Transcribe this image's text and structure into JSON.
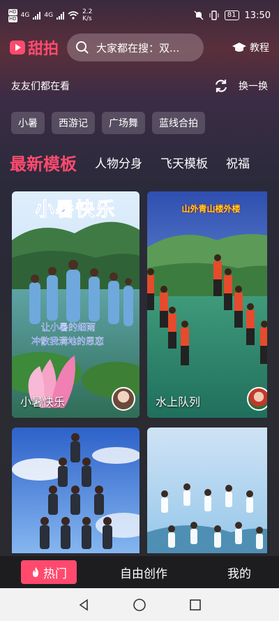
{
  "status_bar": {
    "hd1": "HD",
    "hd2": "HD",
    "net_4g1": "4G",
    "net_4g2": "4G",
    "speed": "2.2",
    "speed_unit": "K/s",
    "battery": "81",
    "time": "13:50"
  },
  "header": {
    "logo_text": "甜拍",
    "search_placeholder": "大家都在搜：双...",
    "tutorial_label": "教程"
  },
  "friends": {
    "title": "友友们都在看",
    "refresh_label": "换一换"
  },
  "chips": [
    "小暑",
    "西游记",
    "广场舞",
    "蓝线合拍"
  ],
  "tabs": [
    "最新模板",
    "人物分身",
    "飞天模板",
    "祝福"
  ],
  "cards": [
    {
      "title": "小暑快乐",
      "overlay": "小暑快乐",
      "poem_1": "让小暑的细雨",
      "poem_2": "冲散我满地的思恋"
    },
    {
      "title": "水上队列",
      "overlay": "山外青山楼外楼"
    },
    {
      "title": ""
    },
    {
      "title": ""
    }
  ],
  "bottom_nav": {
    "hot": "热门",
    "create": "自由创作",
    "mine": "我的"
  },
  "colors": {
    "accent": "#ff4a6e",
    "nav_bg": "#1d1d1f"
  }
}
